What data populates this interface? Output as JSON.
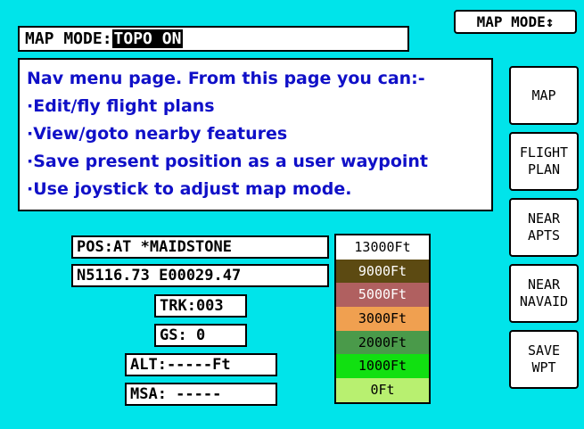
{
  "map_mode_field": {
    "label": "MAP MODE:",
    "value": "TOPO ON"
  },
  "map_mode_button": {
    "label": "MAP MODE↕"
  },
  "help": {
    "lines": [
      "Nav menu page. From this page you can:-",
      "·Edit/fly flight plans",
      "·View/goto nearby features",
      "·Save present position as a user waypoint",
      "·Use joystick to adjust map mode."
    ],
    "text_color": "#1010c8"
  },
  "softkeys": [
    {
      "line1": "MAP",
      "line2": ""
    },
    {
      "line1": "FLIGHT",
      "line2": "PLAN"
    },
    {
      "line1": "NEAR",
      "line2": "APTS"
    },
    {
      "line1": "NEAR",
      "line2": "NAVAID"
    },
    {
      "line1": "SAVE",
      "line2": "WPT"
    }
  ],
  "info": {
    "position": "POS:AT *MAIDSTONE",
    "coordinates": "N5116.73 E00029.47",
    "track": "TRK:003",
    "ground_speed": "GS:  0",
    "altitude": "ALT:-----Ft",
    "msa": "MSA:  -----"
  },
  "altitude_legend": [
    {
      "label": "13000Ft",
      "color": "#ffffff",
      "text_color": "#000000"
    },
    {
      "label": "9000Ft",
      "color": "#5c4a12",
      "text_color": "#ffffff"
    },
    {
      "label": "5000Ft",
      "color": "#b06060",
      "text_color": "#ffffff"
    },
    {
      "label": "3000Ft",
      "color": "#f0a050",
      "text_color": "#000000"
    },
    {
      "label": "2000Ft",
      "color": "#4a9a4a",
      "text_color": "#000000"
    },
    {
      "label": "1000Ft",
      "color": "#11e011",
      "text_color": "#000000"
    },
    {
      "label": "0Ft",
      "color": "#b8f070",
      "text_color": "#000000"
    }
  ],
  "colors": {
    "background": "#00e4ea"
  }
}
